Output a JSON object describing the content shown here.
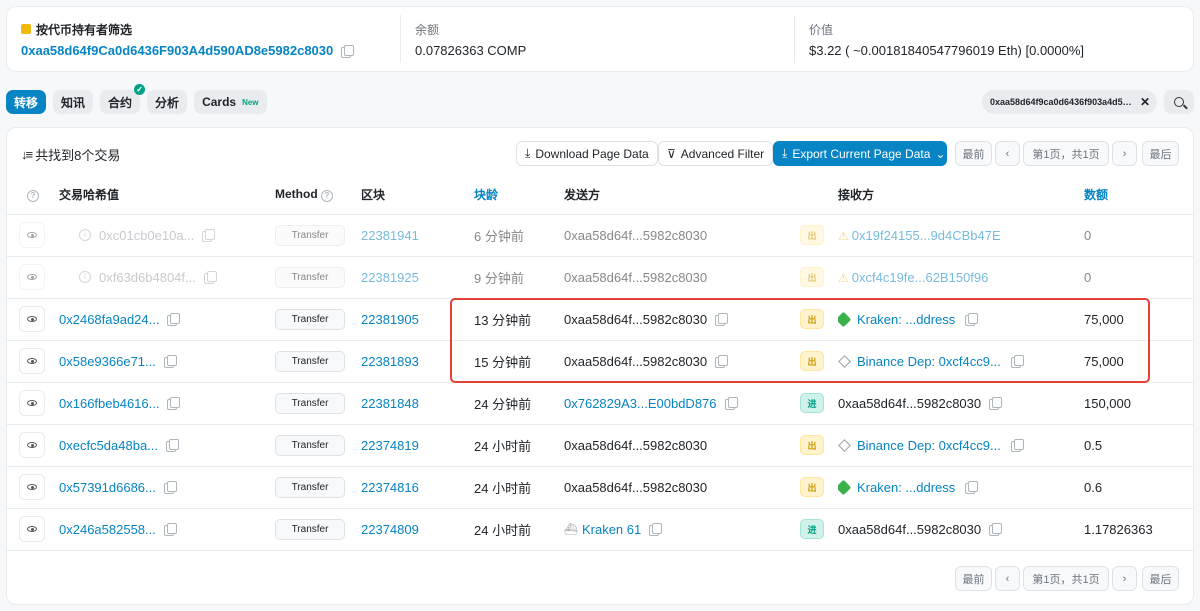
{
  "summary": {
    "filter_label": "按代币持有者筛选",
    "filter_address": "0xaa58d64f9Ca0d6436F903A4d590AD8e5982c8030",
    "balance_label": "余额",
    "balance_value": "0.07826363 COMP",
    "value_label": "价值",
    "value_value": "$3.22 ( ~0.00181840547796019 Eth) [0.0000%]"
  },
  "tabs": [
    {
      "label": "转移",
      "active": true
    },
    {
      "label": "知讯"
    },
    {
      "label": "合约",
      "badge": "✓"
    },
    {
      "label": "分析"
    },
    {
      "label": "Cards",
      "tag": "New"
    }
  ],
  "address_filter": {
    "text": "0xaa58d64f9ca0d6436f903a4d590ad8e5982c8030",
    "clear": "✕"
  },
  "header": {
    "found_text": "共找到8个交易",
    "download": "Download Page Data",
    "advanced_filter": "Advanced Filter",
    "export": "Export Current Page Data"
  },
  "pagination": {
    "first": "最前",
    "prev": "‹",
    "page": "第1页，共1页",
    "next": "›",
    "last": "最后"
  },
  "columns": {
    "hash": "交易哈希值",
    "method": "Method",
    "block": "区块",
    "age": "块龄",
    "from": "发送方",
    "to": "接收方",
    "amount": "数额"
  },
  "rows": [
    {
      "hash": "0xc01cb0e10a...",
      "method": "Transfer",
      "block": "22381941",
      "age": "6 分钟前",
      "from": "0xaa58d64f...5982c8030",
      "dir": "出",
      "to": "0x19f24155...9d4CBb47E",
      "amount": "0"
    },
    {
      "hash": "0xf63d6b4804f...",
      "method": "Transfer",
      "block": "22381925",
      "age": "9 分钟前",
      "from": "0xaa58d64f...5982c8030",
      "dir": "出",
      "to": "0xcf4c19fe...62B150f96",
      "amount": "0"
    },
    {
      "hash": "0x2468fa9ad24...",
      "method": "Transfer",
      "block": "22381905",
      "age": "13 分钟前",
      "from": "0xaa58d64f...5982c8030",
      "dir": "出",
      "to": "Kraken: ...ddress",
      "amount": "75,000"
    },
    {
      "hash": "0x58e9366e71...",
      "method": "Transfer",
      "block": "22381893",
      "age": "15 分钟前",
      "from": "0xaa58d64f...5982c8030",
      "dir": "出",
      "to": "Binance Dep: 0xcf4cc9...",
      "amount": "75,000"
    },
    {
      "hash": "0x166fbeb4616...",
      "method": "Transfer",
      "block": "22381848",
      "age": "24 分钟前",
      "from": "0x762829A3...E00bdD876",
      "dir": "进",
      "to": "0xaa58d64f...5982c8030",
      "amount": "150,000"
    },
    {
      "hash": "0xecfc5da48ba...",
      "method": "Transfer",
      "block": "22374819",
      "age": "24 小时前",
      "from": "0xaa58d64f...5982c8030",
      "dir": "出",
      "to": "Binance Dep: 0xcf4cc9...",
      "amount": "0.5"
    },
    {
      "hash": "0x57391d6686...",
      "method": "Transfer",
      "block": "22374816",
      "age": "24 小时前",
      "from": "0xaa58d64f...5982c8030",
      "dir": "出",
      "to": "Kraken: ...ddress",
      "amount": "0.6"
    },
    {
      "hash": "0x246a582558...",
      "method": "Transfer",
      "block": "22374809",
      "age": "24 小时前",
      "from": "Kraken 61",
      "dir": "进",
      "to": "0xaa58d64f...5982c8030",
      "amount": "1.17826363"
    }
  ],
  "colors": {
    "accent": "#0784c3",
    "highlight": "#e34234",
    "out": "#cc9a06",
    "in": "#00a186"
  }
}
